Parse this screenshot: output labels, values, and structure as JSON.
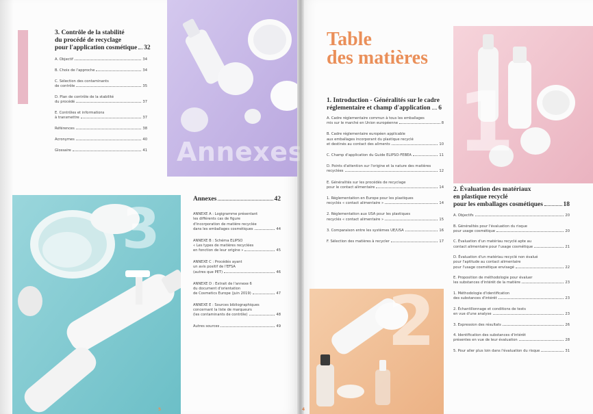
{
  "left_page": {
    "section3": {
      "title_lines": [
        "3. Contrôle de la stabilité",
        "du procédé de recyclage"
      ],
      "title_last": "pour l'application cosmétique",
      "title_page": "32",
      "entries": [
        {
          "lines": [],
          "last": "A. Objectif",
          "page": "34"
        },
        {
          "lines": [],
          "last": "B. Choix de l'approche",
          "page": "34"
        },
        {
          "lines": [
            "C. Sélection des contaminants"
          ],
          "last": "de contrôle",
          "page": "35"
        },
        {
          "lines": [
            "D. Plan de contrôle de la stabilité"
          ],
          "last": "du procédé",
          "page": "37"
        },
        {
          "lines": [
            "E. Contrôles et informations"
          ],
          "last": "à transmettre",
          "page": "37"
        },
        {
          "lines": [],
          "last": "Références",
          "page": "38"
        },
        {
          "lines": [],
          "last": "Acronymes",
          "page": "40"
        },
        {
          "lines": [],
          "last": "Glossaire",
          "page": "41"
        }
      ]
    },
    "annexes_word": "Annexes",
    "big_number": "3",
    "annexes": {
      "title": "Annexes",
      "title_page": "42",
      "entries": [
        {
          "lines": [
            "ANNEXE A : Logigramme présentant",
            "les différents cas de figure",
            "d'incorporation de matière recyclée"
          ],
          "last": "dans les emballages cosmétiques",
          "page": "44"
        },
        {
          "lines": [
            "ANNEXE B : Schéma ELIPSO",
            "« Les types de matières recyclées"
          ],
          "last": "en fonction de leur origine »",
          "page": "45"
        },
        {
          "lines": [
            "ANNEXE C : Procédés ayant",
            "un avis positif de l'EFSA"
          ],
          "last": "(autres que PET)",
          "page": "46"
        },
        {
          "lines": [
            "ANNEXE D : Extrait de l'annexe 6",
            "du document d'orientation"
          ],
          "last": "de Cosmetics Europe (juin 2019)",
          "page": "47"
        },
        {
          "lines": [
            "ANNEXE E : Sources bibliographiques",
            "concernant la liste de marqueurs"
          ],
          "last": "(les contaminants de contrôle)",
          "page": "48"
        },
        {
          "lines": [],
          "last": "Autres sources",
          "page": "49"
        }
      ]
    },
    "folio": "5"
  },
  "right_page": {
    "heading_lines": [
      "Table",
      "des matières"
    ],
    "big_number_1": "1",
    "big_number_2": "2",
    "section1": {
      "title_lines": [
        "1. Introduction - Généralités sur le cadre"
      ],
      "title_last": "réglementaire et champ d'application",
      "title_page": "6",
      "entries": [
        {
          "lines": [
            "A. Cadre réglementaire commun à tous les emballages"
          ],
          "last": "mis sur le marché en Union européenne",
          "page": "8"
        },
        {
          "lines": [
            "B. Cadre réglementaire européen applicable",
            "aux emballages incorporant du plastique recyclé"
          ],
          "last": "et destinés au contact des aliments",
          "page": "10"
        },
        {
          "lines": [],
          "last": "C. Champ d'application du Guide ELIPSO-FEBEA",
          "page": "11"
        },
        {
          "lines": [
            "D. Points d'attention sur l'origine et la nature des matières"
          ],
          "last": "recyclées",
          "page": "12"
        },
        {
          "lines": [
            "E. Généralités sur les procédés de recyclage"
          ],
          "last": "pour le contact alimentaire",
          "page": "14"
        },
        {
          "lines": [
            "1. Réglementation en Europe pour les plastiques"
          ],
          "last": "recyclés « contact alimentaire »",
          "page": "14"
        },
        {
          "lines": [
            "2. Réglementation aux USA pour les plastiques"
          ],
          "last": "recyclés « contact alimentaire »",
          "page": "15"
        },
        {
          "lines": [],
          "last": "3. Comparaison entre les systèmes UE/USA",
          "page": "16"
        },
        {
          "lines": [],
          "last": "F. Sélection des matières à recycler",
          "page": "17"
        }
      ]
    },
    "section2": {
      "title_lines": [
        "2. Évaluation des matériaux",
        "en plastique recyclé"
      ],
      "title_last": "pour les emballages cosmétiques",
      "title_page": "18",
      "entries": [
        {
          "lines": [],
          "last": "A. Objectifs",
          "page": "20"
        },
        {
          "lines": [
            "B. Généralités pour l'évaluation du risque"
          ],
          "last": "pour usage cosmétique",
          "page": "20"
        },
        {
          "lines": [
            "C. Évaluation d'un matériau recyclé apte au"
          ],
          "last": "contact alimentaire pour l'usage cosmétique",
          "page": "21"
        },
        {
          "lines": [
            "D. Évaluation d'un matériau recyclé non évalué",
            "pour l'aptitude au contact alimentaire"
          ],
          "last": "pour l'usage cosmétique envisagé",
          "page": "22"
        },
        {
          "lines": [
            "E. Proposition de méthodologie pour évaluer"
          ],
          "last": "les substances d'intérêt de la matière",
          "page": "23"
        },
        {
          "lines": [
            "1. Méthodologie d'identification"
          ],
          "last": "des substances d'intérêt",
          "page": "23"
        },
        {
          "lines": [
            "2. Échantillonnage et conditions de tests"
          ],
          "last": "en vue d'une analyse",
          "page": "23"
        },
        {
          "lines": [],
          "last": "3. Expression des résultats",
          "page": "26"
        },
        {
          "lines": [
            "4. Identification des substances d'intérêt"
          ],
          "last": "présentes en vue de leur évaluation",
          "page": "28"
        },
        {
          "lines": [],
          "last": "5. Pour aller plus loin dans l'évaluation du risque",
          "page": "31"
        }
      ]
    },
    "folio": "4"
  },
  "colors": {
    "accent": "#ea8f59",
    "pink": "#e9b9c6",
    "lavender": "#c4b4e4",
    "mint": "#8fd0d6",
    "peach": "#f2c09b"
  }
}
